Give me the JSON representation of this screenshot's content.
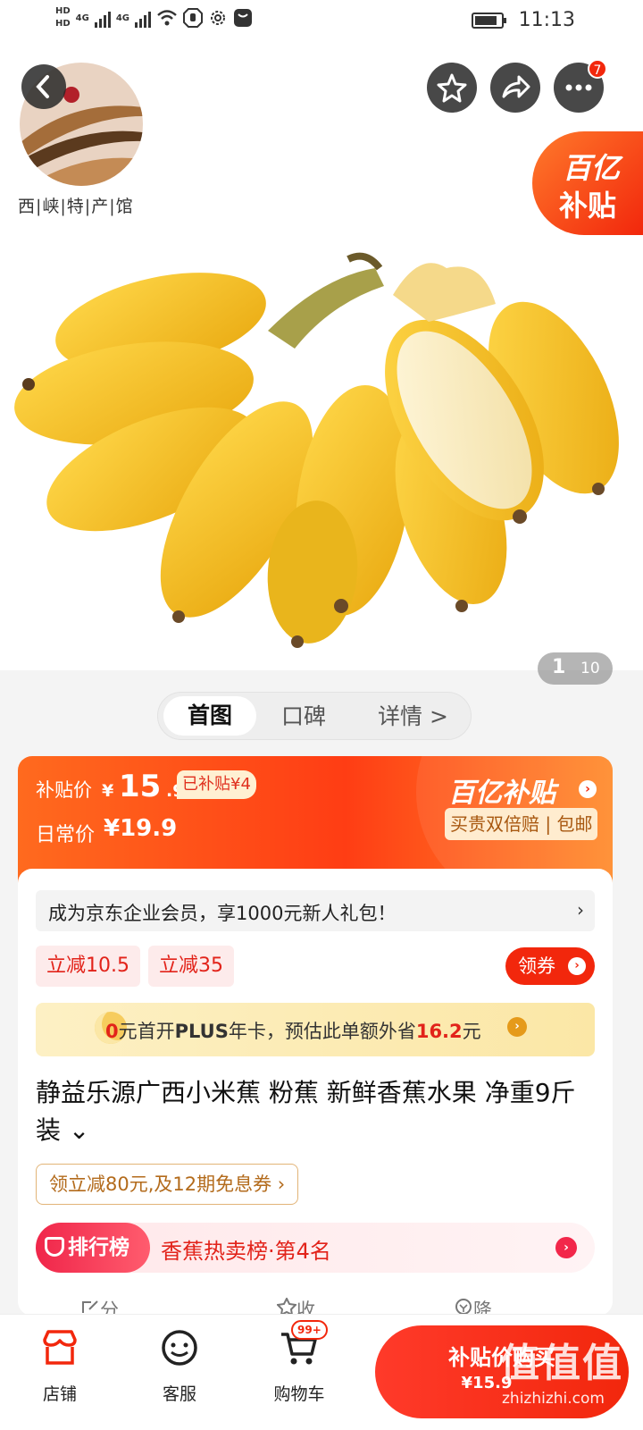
{
  "status_bar": {
    "hd1": "HD",
    "hd2": "HD",
    "net1": "4G",
    "net2": "4G",
    "time": "11:13"
  },
  "shop": {
    "name": "西|峡|特|产|馆"
  },
  "header": {
    "cart_count": "7"
  },
  "subsidy_tag": {
    "line1": "百亿",
    "line2": "补贴"
  },
  "gallery": {
    "current": "1",
    "total": "10"
  },
  "tabs": [
    {
      "label": "首图"
    },
    {
      "label": "口碑"
    },
    {
      "label": "详情 >"
    }
  ],
  "price": {
    "label": "补贴价",
    "yen": "¥",
    "integer": "15",
    "decimal": ".9",
    "subsidy_chip": "已补贴¥4",
    "daily_label": "日常价",
    "daily_price": "¥19.9",
    "brand": "百亿补贴",
    "perks": "买贵双倍赔 | 包邮"
  },
  "member_banner": {
    "text": "成为京东企业会员，享1000元新人礼包！",
    "chevron": "›"
  },
  "coupons": [
    {
      "label": "立减10.5"
    },
    {
      "label": "立减35"
    }
  ],
  "claim_button": {
    "label": "领券"
  },
  "plus_banner": {
    "prefix": "0",
    "middle": "元首开",
    "plus": "PLUS",
    "suffix": "年卡，预估此单额外省",
    "amount": "16.2",
    "unit": "元"
  },
  "product": {
    "title": "静益乐源广西小米蕉 粉蕉 新鲜香蕉水果 净重9斤装 ⌄"
  },
  "promo": {
    "text": "领立减80元,及12期免息券 ›"
  },
  "ranking": {
    "pill": "排行榜",
    "text": "香蕉热卖榜·第4名"
  },
  "actions": [
    {
      "label": "分享"
    },
    {
      "label": "收藏"
    },
    {
      "label": "降价通知"
    }
  ],
  "bottom_nav": [
    {
      "label": "店铺"
    },
    {
      "label": "客服"
    },
    {
      "label": "购物车"
    }
  ],
  "cart_badge": "99+",
  "buy_button": {
    "line1": "补贴价购买",
    "line2": "¥15.9"
  },
  "watermark": {
    "main": "值值值",
    "sub": "zhizhizhi.com"
  },
  "colors": {
    "accent": "#f2270c",
    "subsidy_orange": "#ff6a1e",
    "banana_yellow": "#f5c22a"
  }
}
